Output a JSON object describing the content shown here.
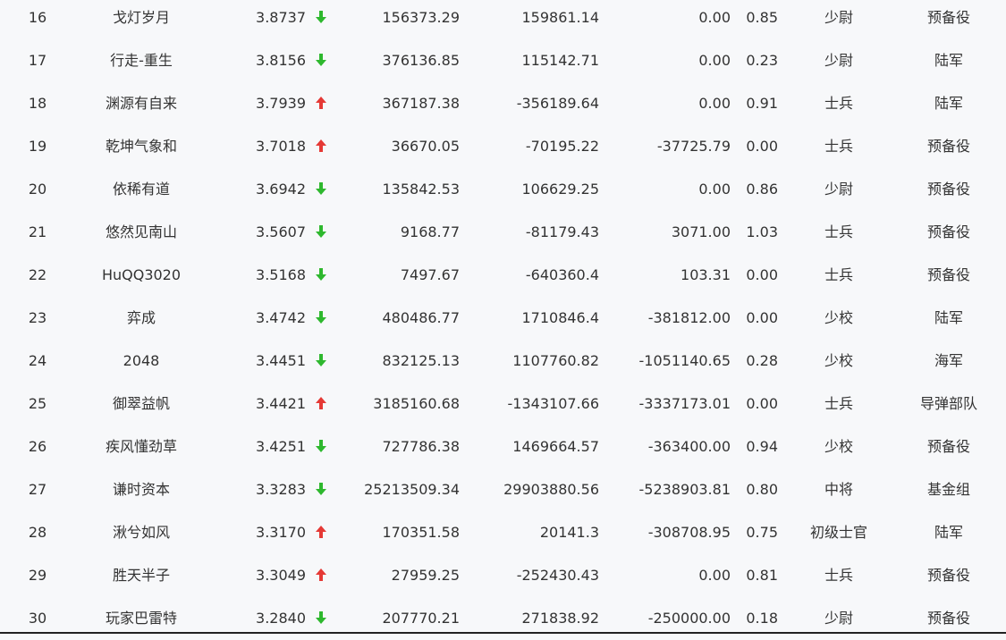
{
  "colors": {
    "up": "#e53935",
    "down": "#2eb82e",
    "text": "#333333",
    "background": "#f7f8fa"
  },
  "rows": [
    {
      "rank": "16",
      "name": "戈灯岁月",
      "score": "3.8737",
      "trend": "down",
      "v1": "156373.29",
      "v2": "159861.14",
      "v3": "0.00",
      "v4": "0.85",
      "rank_title": "少尉",
      "group": "预备役"
    },
    {
      "rank": "17",
      "name": "行走-重生",
      "score": "3.8156",
      "trend": "down",
      "v1": "376136.85",
      "v2": "115142.71",
      "v3": "0.00",
      "v4": "0.23",
      "rank_title": "少尉",
      "group": "陆军"
    },
    {
      "rank": "18",
      "name": "渊源有自来",
      "score": "3.7939",
      "trend": "up",
      "v1": "367187.38",
      "v2": "-356189.64",
      "v3": "0.00",
      "v4": "0.91",
      "rank_title": "士兵",
      "group": "陆军"
    },
    {
      "rank": "19",
      "name": "乾坤气象和",
      "score": "3.7018",
      "trend": "up",
      "v1": "36670.05",
      "v2": "-70195.22",
      "v3": "-37725.79",
      "v4": "0.00",
      "rank_title": "士兵",
      "group": "预备役"
    },
    {
      "rank": "20",
      "name": "依稀有道",
      "score": "3.6942",
      "trend": "down",
      "v1": "135842.53",
      "v2": "106629.25",
      "v3": "0.00",
      "v4": "0.86",
      "rank_title": "少尉",
      "group": "预备役"
    },
    {
      "rank": "21",
      "name": "悠然见南山",
      "score": "3.5607",
      "trend": "down",
      "v1": "9168.77",
      "v2": "-81179.43",
      "v3": "3071.00",
      "v4": "1.03",
      "rank_title": "士兵",
      "group": "预备役"
    },
    {
      "rank": "22",
      "name": "HuQQ3020",
      "score": "3.5168",
      "trend": "down",
      "v1": "7497.67",
      "v2": "-640360.4",
      "v3": "103.31",
      "v4": "0.00",
      "rank_title": "士兵",
      "group": "预备役"
    },
    {
      "rank": "23",
      "name": "弈成",
      "score": "3.4742",
      "trend": "down",
      "v1": "480486.77",
      "v2": "1710846.4",
      "v3": "-381812.00",
      "v4": "0.00",
      "rank_title": "少校",
      "group": "陆军"
    },
    {
      "rank": "24",
      "name": "2048",
      "score": "3.4451",
      "trend": "down",
      "v1": "832125.13",
      "v2": "1107760.82",
      "v3": "-1051140.65",
      "v4": "0.28",
      "rank_title": "少校",
      "group": "海军"
    },
    {
      "rank": "25",
      "name": "御翠益帆",
      "score": "3.4421",
      "trend": "up",
      "v1": "3185160.68",
      "v2": "-1343107.66",
      "v3": "-3337173.01",
      "v4": "0.00",
      "rank_title": "士兵",
      "group": "导弹部队"
    },
    {
      "rank": "26",
      "name": "疾风懂劲草",
      "score": "3.4251",
      "trend": "down",
      "v1": "727786.38",
      "v2": "1469664.57",
      "v3": "-363400.00",
      "v4": "0.94",
      "rank_title": "少校",
      "group": "预备役"
    },
    {
      "rank": "27",
      "name": "谦时资本",
      "score": "3.3283",
      "trend": "down",
      "v1": "25213509.34",
      "v2": "29903880.56",
      "v3": "-5238903.81",
      "v4": "0.80",
      "rank_title": "中将",
      "group": "基金组"
    },
    {
      "rank": "28",
      "name": "湫兮如风",
      "score": "3.3170",
      "trend": "up",
      "v1": "170351.58",
      "v2": "20141.3",
      "v3": "-308708.95",
      "v4": "0.75",
      "rank_title": "初级士官",
      "group": "陆军"
    },
    {
      "rank": "29",
      "name": "胜天半子",
      "score": "3.3049",
      "trend": "up",
      "v1": "27959.25",
      "v2": "-252430.43",
      "v3": "0.00",
      "v4": "0.81",
      "rank_title": "士兵",
      "group": "预备役"
    },
    {
      "rank": "30",
      "name": "玩家巴雷特",
      "score": "3.2840",
      "trend": "down",
      "v1": "207770.21",
      "v2": "271838.92",
      "v3": "-250000.00",
      "v4": "0.18",
      "rank_title": "少尉",
      "group": "预备役"
    }
  ]
}
